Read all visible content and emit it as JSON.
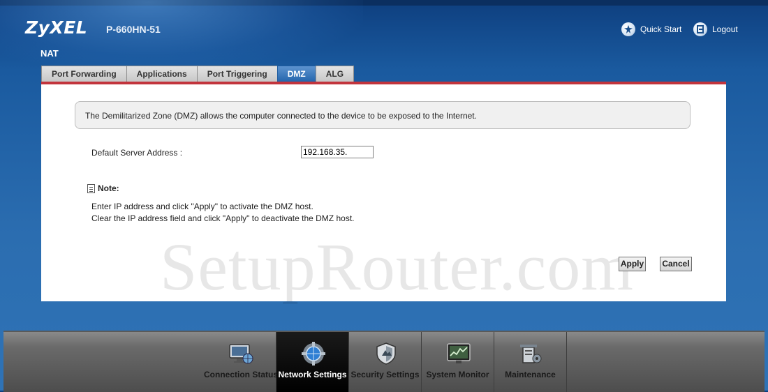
{
  "header": {
    "logo_text": "ZyXEL",
    "model": "P-660HN-51",
    "quick_start_label": "Quick Start",
    "logout_label": "Logout",
    "page_title": "NAT"
  },
  "tabs": [
    {
      "label": "Port Forwarding",
      "active": false
    },
    {
      "label": "Applications",
      "active": false
    },
    {
      "label": "Port Triggering",
      "active": false
    },
    {
      "label": "DMZ",
      "active": true
    },
    {
      "label": "ALG",
      "active": false
    }
  ],
  "main": {
    "info_text": "The Demilitarized Zone (DMZ) allows the computer connected to the device to be exposed to the Internet.",
    "default_server_label": "Default Server Address :",
    "default_server_value": "192.168.35.",
    "note_title": "Note:",
    "note_lines": [
      "Enter IP address and click \"Apply\" to activate the DMZ host.",
      "Clear the IP address field and click \"Apply\" to deactivate the DMZ host."
    ],
    "apply_label": "Apply",
    "cancel_label": "Cancel",
    "watermark": "SetupRouter.com"
  },
  "bottom_nav": [
    {
      "label": "Connection Status",
      "icon": "monitor-globe-icon",
      "active": false
    },
    {
      "label": "Network Settings",
      "icon": "globe-gear-icon",
      "active": true
    },
    {
      "label": "Security Settings",
      "icon": "shield-icon",
      "active": false
    },
    {
      "label": "System Monitor",
      "icon": "chart-monitor-icon",
      "active": false
    },
    {
      "label": "Maintenance",
      "icon": "tools-icon",
      "active": false
    }
  ],
  "colors": {
    "background": "#1f5d9f",
    "active_tab": "#2466ad",
    "panel_accent": "#c2343c",
    "bottom_bar": "#5a5a5a"
  }
}
